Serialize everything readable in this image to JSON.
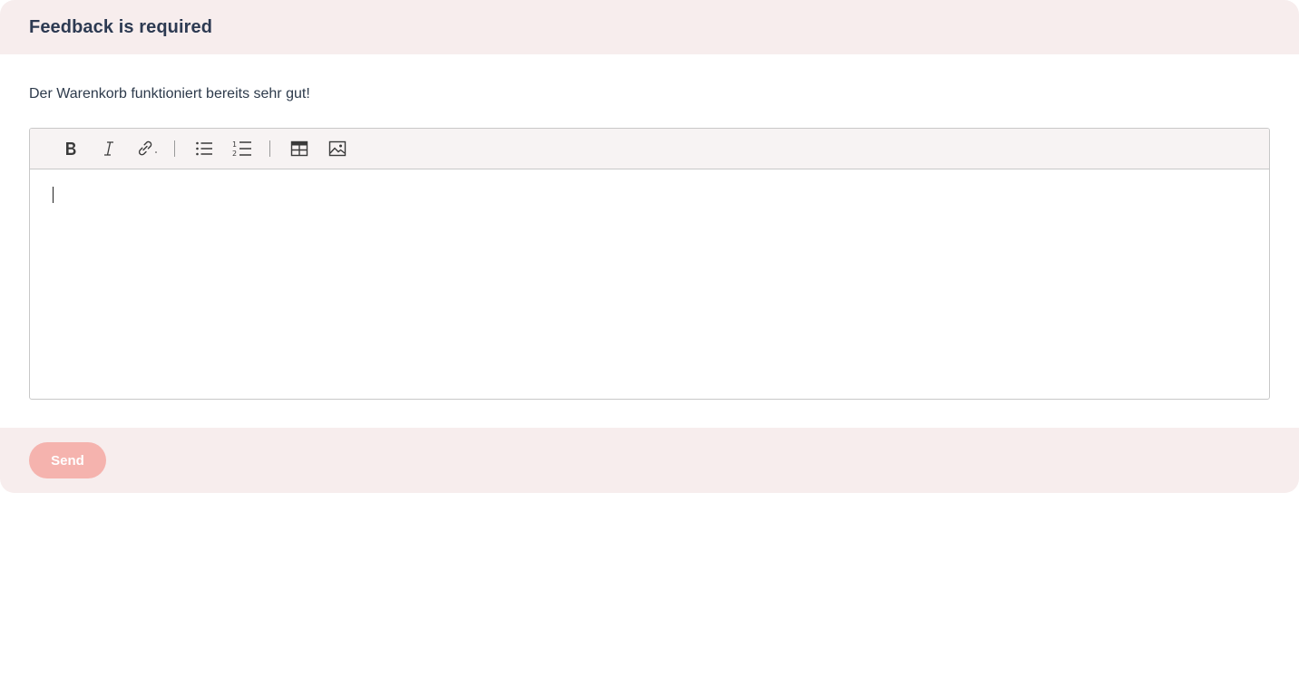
{
  "header": {
    "title": "Feedback is required"
  },
  "body": {
    "prompt_text": "Der Warenkorb funktioniert bereits sehr gut!"
  },
  "editor": {
    "toolbar": [
      {
        "name": "bold-button",
        "icon": "bold-icon"
      },
      {
        "name": "italic-button",
        "icon": "italic-icon"
      },
      {
        "name": "link-button",
        "icon": "link-icon"
      },
      {
        "name": "bulleted-list-button",
        "icon": "bulleted-list-icon"
      },
      {
        "name": "numbered-list-button",
        "icon": "numbered-list-icon"
      },
      {
        "name": "insert-table-button",
        "icon": "table-icon"
      },
      {
        "name": "insert-image-button",
        "icon": "image-icon"
      }
    ],
    "content": ""
  },
  "footer": {
    "send_label": "Send",
    "send_disabled": true
  },
  "colors": {
    "header_bg": "#f7eded",
    "footer_bg": "#f7eded",
    "toolbar_bg": "#f7f3f3",
    "send_button_bg": "#f5b3ae",
    "title_color": "#2d3a52"
  }
}
